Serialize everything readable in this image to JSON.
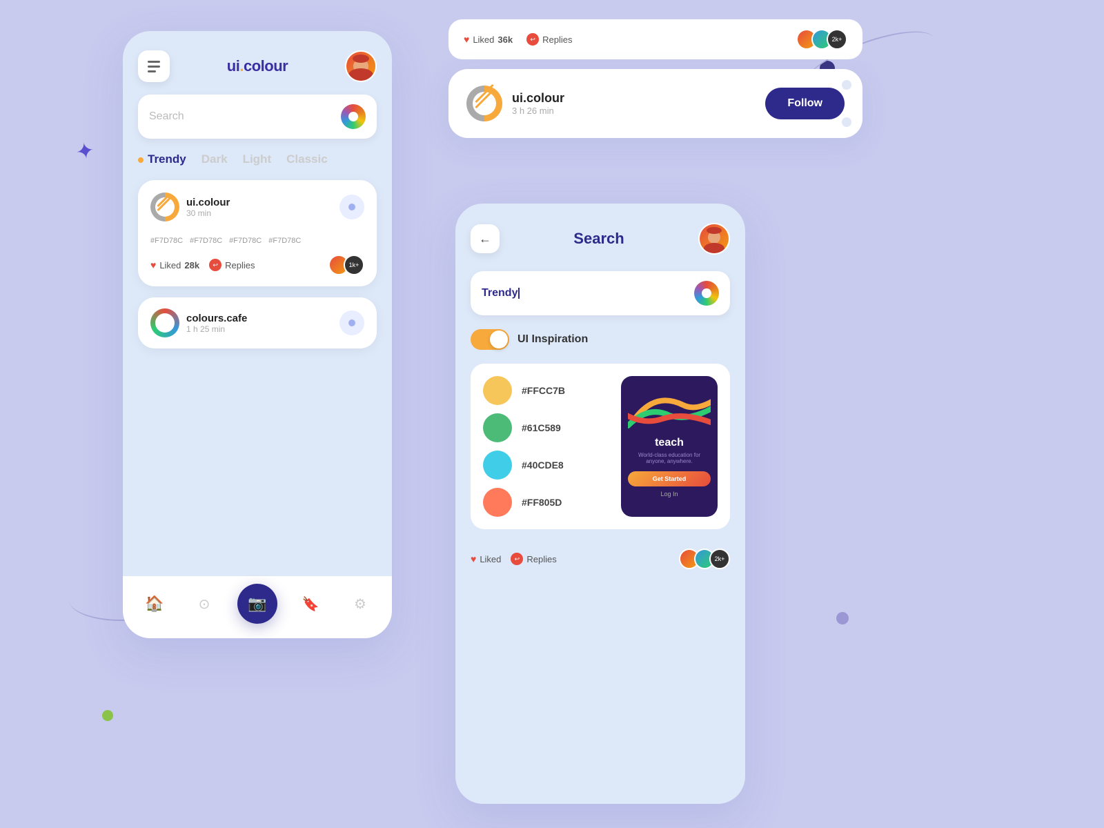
{
  "app": {
    "logo": "ui.colour",
    "logo_dot": ".",
    "background_color": "#c8caee"
  },
  "left_phone": {
    "header": {
      "logo": "ui.colour",
      "menu_icon": "menu-bars"
    },
    "search": {
      "placeholder": "Search"
    },
    "tabs": [
      {
        "label": "Trendy",
        "active": true
      },
      {
        "label": "Dark",
        "active": false
      },
      {
        "label": "Light",
        "active": false
      },
      {
        "label": "Classic",
        "active": false
      }
    ],
    "card1": {
      "name": "ui.colour",
      "time": "30 min",
      "swatches": [
        {
          "color": "#7c5cbf",
          "label": "#F7D78C"
        },
        {
          "color": "#f0c94e",
          "label": "#F7D78C"
        },
        {
          "color": "#b8cef0",
          "label": "#F7D78C"
        },
        {
          "color": "#f0a8a0",
          "label": "#F7D78C"
        }
      ],
      "liked": "28k",
      "liked_label": "Liked",
      "replies_label": "Replies",
      "avatar_count": "1k+"
    },
    "card2": {
      "name": "colours.cafe",
      "time": "1 h 25 min"
    },
    "nav": {
      "items": [
        "home",
        "circle",
        "camera",
        "bookmark",
        "settings"
      ]
    }
  },
  "top_right": {
    "liked": "36k",
    "liked_label": "Liked",
    "replies_label": "Replies",
    "avatar_count": "2k+",
    "follow_card": {
      "name": "ui.colour",
      "time": "3 h 26 min",
      "follow_btn": "Follow"
    }
  },
  "right_phone": {
    "header": {
      "title": "Search",
      "back": "←"
    },
    "search_input": {
      "value": "Trendy",
      "cursor": true
    },
    "toggle": {
      "label": "UI Inspiration",
      "enabled": true
    },
    "inspiration_card": {
      "colors": [
        {
          "hex": "#FFCC7B",
          "color": "#f7c65b"
        },
        {
          "hex": "#61C589",
          "color": "#4cbb78"
        },
        {
          "hex": "#40CDE8",
          "color": "#40cde8"
        },
        {
          "hex": "#FF805D",
          "color": "#ff7a5a"
        }
      ],
      "app_preview": {
        "title": "teach",
        "subtitle": "World-class education for anyone, anywhere.",
        "get_started": "Get Started",
        "log_in": "Log In"
      }
    }
  }
}
